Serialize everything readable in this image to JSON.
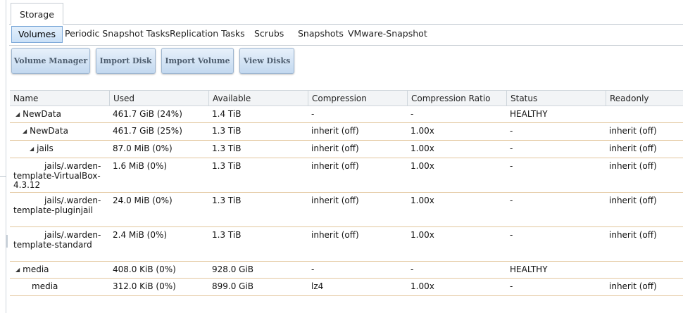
{
  "app": {
    "top_tab": "Storage"
  },
  "sub_tabs": [
    {
      "label": "Volumes",
      "active": true
    },
    {
      "label": "Periodic Snapshot Tasks",
      "active": false
    },
    {
      "label": "Replication Tasks",
      "active": false
    },
    {
      "label": "Scrubs",
      "active": false
    },
    {
      "label": "Snapshots",
      "active": false
    },
    {
      "label": "VMware-Snapshot",
      "active": false
    }
  ],
  "buttons": {
    "volume_manager": "Volume Manager",
    "import_disk": "Import Disk",
    "import_volume": "Import Volume",
    "view_disks": "View Disks"
  },
  "table": {
    "columns": {
      "name": "Name",
      "used": "Used",
      "available": "Available",
      "compression": "Compression",
      "compression_ratio": "Compression Ratio",
      "status": "Status",
      "readonly": "Readonly"
    },
    "rows": [
      {
        "name": "NewData",
        "expander": "◢",
        "used": "461.7 GiB (24%)",
        "available": "1.4 TiB",
        "compression": "-",
        "compression_ratio": "-",
        "status": "HEALTHY",
        "readonly": ""
      },
      {
        "name": "NewData",
        "expander": "◢",
        "used": "461.7 GiB (25%)",
        "available": "1.3 TiB",
        "compression": "inherit (off)",
        "compression_ratio": "1.00x",
        "status": "-",
        "readonly": "inherit (off)"
      },
      {
        "name": "jails",
        "expander": "◢",
        "used": "87.0 MiB (0%)",
        "available": "1.3 TiB",
        "compression": "inherit (off)",
        "compression_ratio": "1.00x",
        "status": "-",
        "readonly": "inherit (off)"
      },
      {
        "name": "jails/.warden-template-VirtualBox-4.3.12",
        "expander": "",
        "used": "1.6 MiB (0%)",
        "available": "1.3 TiB",
        "compression": "inherit (off)",
        "compression_ratio": "1.00x",
        "status": "-",
        "readonly": "inherit (off)"
      },
      {
        "name": "jails/.warden-template-pluginjail",
        "expander": "",
        "used": "24.0 MiB (0%)",
        "available": "1.3 TiB",
        "compression": "inherit (off)",
        "compression_ratio": "1.00x",
        "status": "-",
        "readonly": "inherit (off)"
      },
      {
        "name": "jails/.warden-template-standard",
        "expander": "",
        "used": "2.4 MiB (0%)",
        "available": "1.3 TiB",
        "compression": "inherit (off)",
        "compression_ratio": "1.00x",
        "status": "-",
        "readonly": "inherit (off)"
      },
      {
        "name": "media",
        "expander": "◢",
        "used": "408.0 KiB (0%)",
        "available": "928.0 GiB",
        "compression": "-",
        "compression_ratio": "-",
        "status": "HEALTHY",
        "readonly": ""
      },
      {
        "name": "media",
        "expander": "",
        "used": "312.0 KiB (0%)",
        "available": "899.0 GiB",
        "compression": "lz4",
        "compression_ratio": "1.00x",
        "status": "-",
        "readonly": "inherit (off)"
      }
    ]
  }
}
